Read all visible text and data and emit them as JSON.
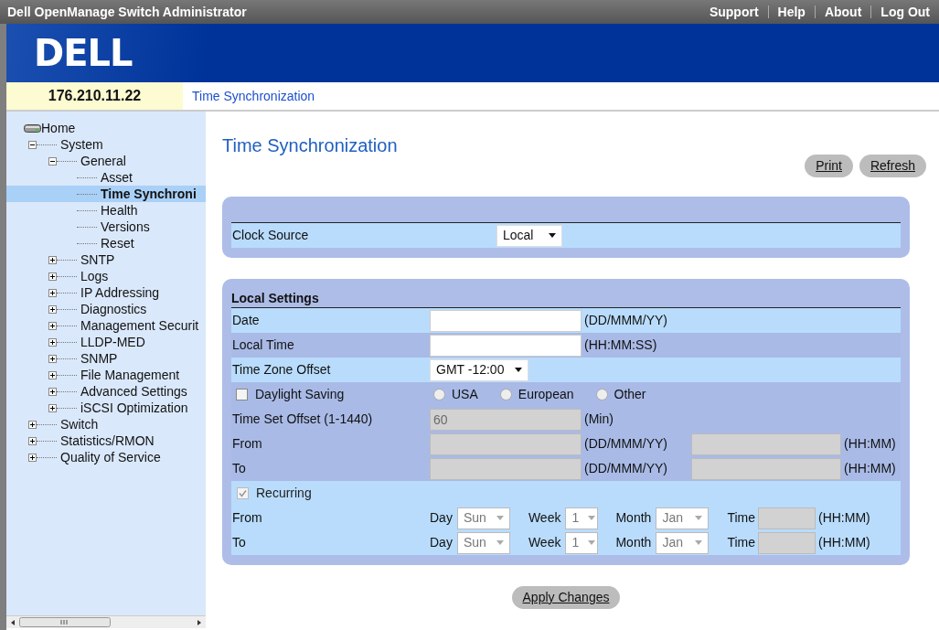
{
  "title_bar": {
    "title": "Dell OpenManage Switch Administrator",
    "links": [
      "Support",
      "Help",
      "About",
      "Log Out"
    ]
  },
  "logo": {
    "text": "DELL"
  },
  "header": {
    "address": "176.210.11.22",
    "breadcrumb": "Time Synchronization"
  },
  "tree": [
    {
      "label": "Home",
      "selected": false,
      "children": [
        {
          "label": "System",
          "expanded": true,
          "selected": false,
          "children": [
            {
              "label": "General",
              "expanded": true,
              "selected": false,
              "children": [
                {
                  "label": "Asset",
                  "selected": false
                },
                {
                  "label": "Time Synchroni",
                  "selected": true
                },
                {
                  "label": "Health",
                  "selected": false
                },
                {
                  "label": "Versions",
                  "selected": false
                },
                {
                  "label": "Reset",
                  "selected": false
                }
              ]
            },
            {
              "label": "SNTP",
              "expanded": false,
              "selected": false
            },
            {
              "label": "Logs",
              "expanded": false,
              "selected": false
            },
            {
              "label": "IP Addressing",
              "expanded": false,
              "selected": false
            },
            {
              "label": "Diagnostics",
              "expanded": false,
              "selected": false
            },
            {
              "label": "Management Securit",
              "expanded": false,
              "selected": false
            },
            {
              "label": "LLDP-MED",
              "expanded": false,
              "selected": false
            },
            {
              "label": "SNMP",
              "expanded": false,
              "selected": false
            },
            {
              "label": "File Management",
              "expanded": false,
              "selected": false
            },
            {
              "label": "Advanced Settings",
              "expanded": false,
              "selected": false
            },
            {
              "label": "iSCSI Optimization",
              "expanded": false,
              "selected": false
            }
          ]
        },
        {
          "label": "Switch",
          "expanded": false,
          "selected": false
        },
        {
          "label": "Statistics/RMON",
          "expanded": false,
          "selected": false
        },
        {
          "label": "Quality of Service",
          "expanded": false,
          "selected": false
        }
      ]
    }
  ],
  "page": {
    "title": "Time Synchronization",
    "buttons": [
      "Print",
      "Refresh"
    ]
  },
  "clock_panel": {
    "label": "Clock Source",
    "value": "Local"
  },
  "local_settings": {
    "title": "Local Settings",
    "rows": [
      {
        "kind": "input",
        "shaded": false,
        "label": "Date",
        "hint": "(DD/MMM/YY)",
        "disabled": false
      },
      {
        "kind": "input",
        "shaded": true,
        "label": "Local Time",
        "hint": "(HH:MM:SS)",
        "disabled": false
      },
      {
        "kind": "select",
        "shaded": false,
        "label": "Time Zone Offset",
        "value": "GMT -12:00"
      },
      {
        "kind": "check_options",
        "shaded": true,
        "label": "Daylight Saving",
        "checked": false,
        "options": [
          {
            "label": "USA",
            "selected": false
          },
          {
            "label": "European",
            "selected": false
          },
          {
            "label": "Other",
            "selected": false
          }
        ]
      },
      {
        "kind": "input",
        "shaded": true,
        "label": "Time Set Offset (1-1440)",
        "value": "60",
        "hint": "(Min)",
        "disabled": true
      },
      {
        "kind": "range",
        "shaded": true,
        "label": "From",
        "date_hint": "(DD/MMM/YY)",
        "time_hint": "(HH:MM)",
        "disabled": true
      },
      {
        "kind": "range",
        "shaded": true,
        "label": "To",
        "date_hint": "(DD/MMM/YY)",
        "time_hint": "(HH:MM)",
        "disabled": true
      },
      {
        "kind": "checkbox",
        "shaded": false,
        "label": "Recurring",
        "checked": true,
        "disabled": true
      },
      {
        "kind": "recurring",
        "shaded": false,
        "label": "From",
        "day_label": "Day",
        "day": "Sun",
        "week_label": "Week",
        "week": "1",
        "month_label": "Month",
        "month": "Jan",
        "time_label": "Time",
        "time_hint": "(HH:MM)",
        "disabled": true
      },
      {
        "kind": "recurring",
        "shaded": false,
        "label": "To",
        "day_label": "Day",
        "day": "Sun",
        "week_label": "Week",
        "week": "1",
        "month_label": "Month",
        "month": "Jan",
        "time_label": "Time",
        "time_hint": "(HH:MM)",
        "disabled": true
      }
    ]
  },
  "apply_button": "Apply Changes"
}
